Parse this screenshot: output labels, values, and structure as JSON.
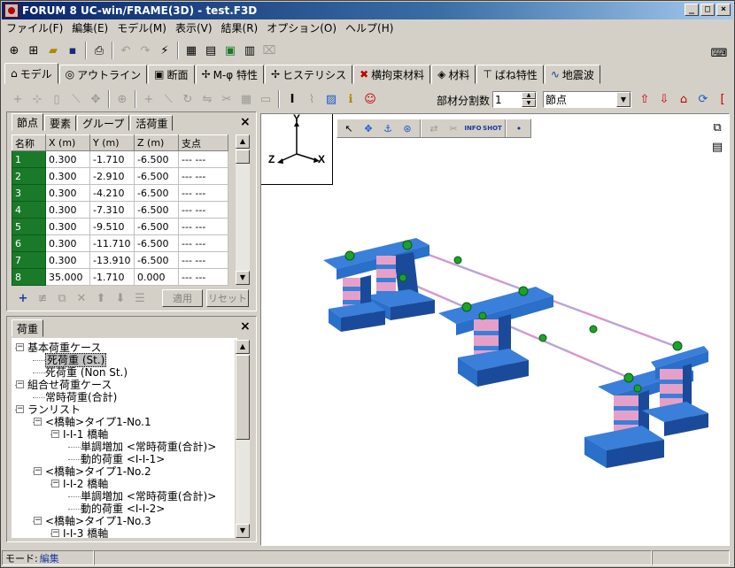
{
  "window": {
    "title": "FORUM 8  UC-win/FRAME(3D) - test.F3D",
    "buttons": [
      "_",
      "□",
      "×"
    ]
  },
  "menu": [
    "ファイル(F)",
    "編集(E)",
    "モデル(M)",
    "表示(V)",
    "結果(R)",
    "オプション(O)",
    "ヘルプ(H)"
  ],
  "main_tabs": [
    {
      "label": "モデル",
      "icon": "⌂"
    },
    {
      "label": "アウトライン",
      "icon": "◎"
    },
    {
      "label": "断面",
      "icon": "▣"
    },
    {
      "label": "M-φ 特性",
      "icon": "✢"
    },
    {
      "label": "ヒステリシス",
      "icon": "✢"
    },
    {
      "label": "横拘束材料",
      "icon": "✖"
    },
    {
      "label": "材料",
      "icon": "◈"
    },
    {
      "label": "ばね特性",
      "icon": "⊤"
    },
    {
      "label": "地震波",
      "icon": "∿"
    }
  ],
  "toolbar2": {
    "division_label": "部材分割数",
    "division_value": "1",
    "mode_value": "節点"
  },
  "left_panel": {
    "tabs": [
      "節点",
      "要素",
      "グループ",
      "活荷重"
    ],
    "close": "×",
    "columns": [
      "名称",
      "X (m)",
      "Y (m)",
      "Z (m)",
      "支点"
    ],
    "rows": [
      [
        "1",
        "0.300",
        "-1.710",
        "-6.500",
        "--- ---"
      ],
      [
        "2",
        "0.300",
        "-2.910",
        "-6.500",
        "--- ---"
      ],
      [
        "3",
        "0.300",
        "-4.210",
        "-6.500",
        "--- ---"
      ],
      [
        "4",
        "0.300",
        "-7.310",
        "-6.500",
        "--- ---"
      ],
      [
        "5",
        "0.300",
        "-9.510",
        "-6.500",
        "--- ---"
      ],
      [
        "6",
        "0.300",
        "-11.710",
        "-6.500",
        "--- ---"
      ],
      [
        "7",
        "0.300",
        "-13.910",
        "-6.500",
        "--- ---"
      ],
      [
        "8",
        "35.000",
        "-1.710",
        "0.000",
        "--- ---"
      ]
    ],
    "apply_label": "適用",
    "reset_label": "リセット"
  },
  "load_panel": {
    "tab": "荷重",
    "close": "×",
    "tree": [
      {
        "label": "基本荷重ケース",
        "level": 0,
        "expander": "−"
      },
      {
        "label": "死荷重 (St.)",
        "level": 1,
        "selected": true
      },
      {
        "label": "死荷重 (Non St.)",
        "level": 1
      },
      {
        "label": "組合せ荷重ケース",
        "level": 0,
        "expander": "−"
      },
      {
        "label": "常時荷重(合計)",
        "level": 1
      },
      {
        "label": "ランリスト",
        "level": 0,
        "expander": "−"
      },
      {
        "label": "<橋軸>タイプ1-No.1",
        "level": 1,
        "expander": "−"
      },
      {
        "label": "I-I-1 橋軸",
        "level": 2,
        "expander": "−"
      },
      {
        "label": "単調増加 <常時荷重(合計)>",
        "level": 3
      },
      {
        "label": "動的荷重 <I-I-1>",
        "level": 3
      },
      {
        "label": "<橋軸>タイプ1-No.2",
        "level": 1,
        "expander": "−"
      },
      {
        "label": "I-I-2 橋軸",
        "level": 2,
        "expander": "−"
      },
      {
        "label": "単調増加 <常時荷重(合計)>",
        "level": 3
      },
      {
        "label": "動的荷重 <I-I-2>",
        "level": 3
      },
      {
        "label": "<橋軸>タイプ1-No.3",
        "level": 1,
        "expander": "−"
      },
      {
        "label": "I-I-3 橋軸",
        "level": 2,
        "expander": "−"
      }
    ]
  },
  "view3d": {
    "axis_y": "Y",
    "axis_z": "Z",
    "axis_x": "X",
    "toolbar_info": "INFO",
    "toolbar_shot": "SHOT"
  },
  "status": {
    "mode_label": "モード:",
    "mode_value": "編集"
  },
  "colors": {
    "pier": "#2a6fc9",
    "pier_band": "#e6a0c8",
    "node": "#1aa32a",
    "selection": "#0a246a"
  }
}
